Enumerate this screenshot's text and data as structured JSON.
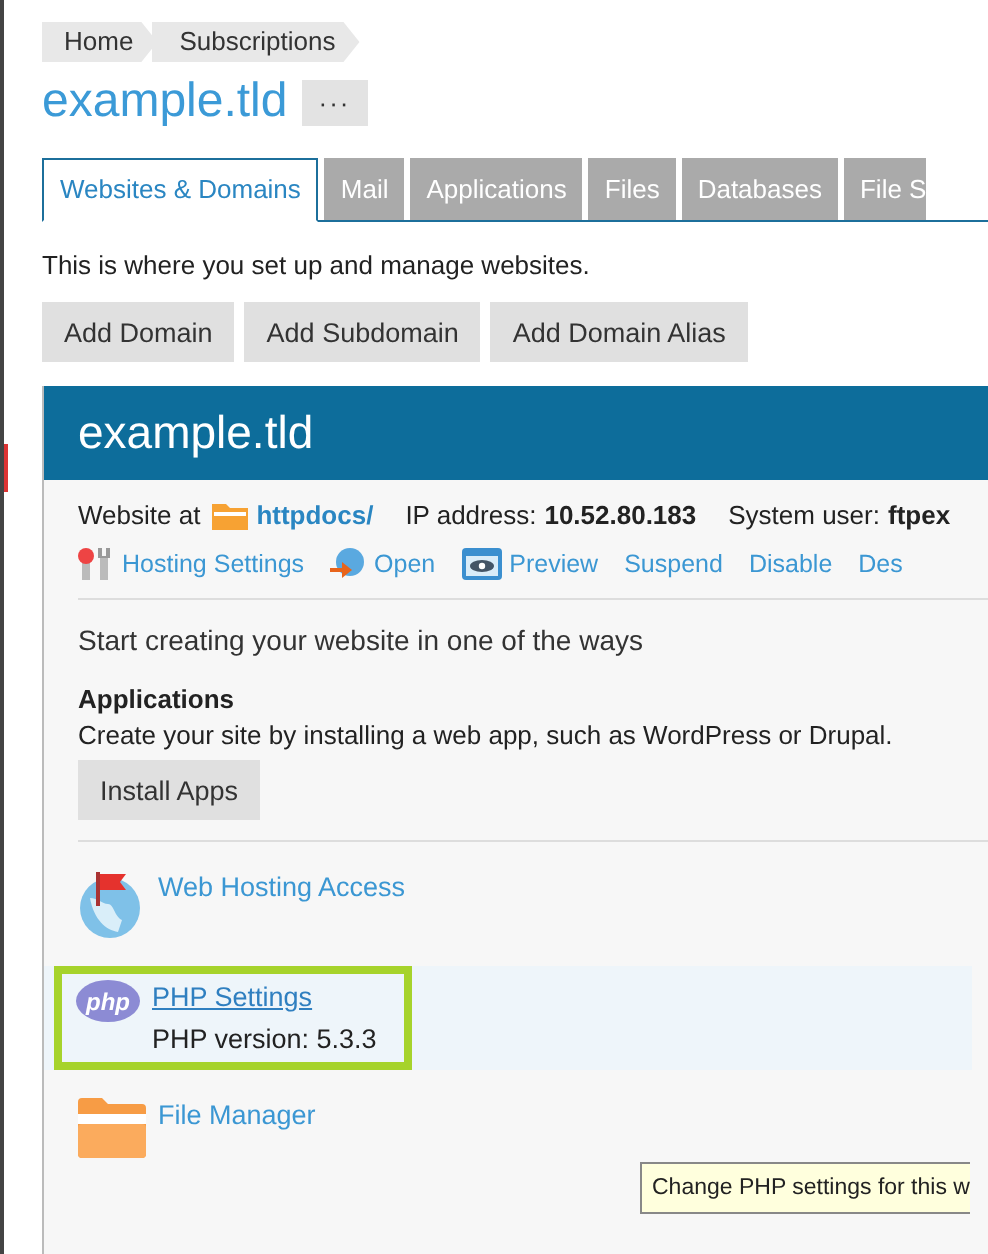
{
  "breadcrumbs": [
    "Home",
    "Subscriptions"
  ],
  "page_title": "example.tld",
  "more_button": "···",
  "tabs": [
    {
      "label": "Websites & Domains",
      "selected": true
    },
    {
      "label": "Mail",
      "selected": false
    },
    {
      "label": "Applications",
      "selected": false
    },
    {
      "label": "Files",
      "selected": false
    },
    {
      "label": "Databases",
      "selected": false
    },
    {
      "label": "File S",
      "selected": false
    }
  ],
  "intro": "This is where you set up and manage websites.",
  "buttons": [
    "Add Domain",
    "Add Subdomain",
    "Add Domain Alias"
  ],
  "domain_panel": {
    "title": "example.tld",
    "info": {
      "website_at_label": "Website at",
      "document_root": "httpdocs/",
      "ip_label": "IP address:",
      "ip": "10.52.80.183",
      "user_label": "System user:",
      "user": "ftpex"
    },
    "actions": [
      {
        "label": "Hosting Settings"
      },
      {
        "label": "Open"
      },
      {
        "label": "Preview"
      },
      {
        "label": "Suspend"
      },
      {
        "label": "Disable"
      },
      {
        "label": "Des"
      }
    ],
    "start_text": "Start creating your website in one of the ways",
    "applications": {
      "heading": "Applications",
      "description": "Create your site by installing a web app, such as WordPress or Drupal.",
      "button": "Install Apps"
    },
    "tools": [
      {
        "label": "Web Hosting Access",
        "highlighted": false
      },
      {
        "label": "PHP Settings",
        "sublabel": "PHP version: 5.3.3",
        "icon_text": "php",
        "highlighted": true
      },
      {
        "label": "File Manager",
        "highlighted": false
      }
    ]
  },
  "tooltip": "Change PHP settings for this w"
}
